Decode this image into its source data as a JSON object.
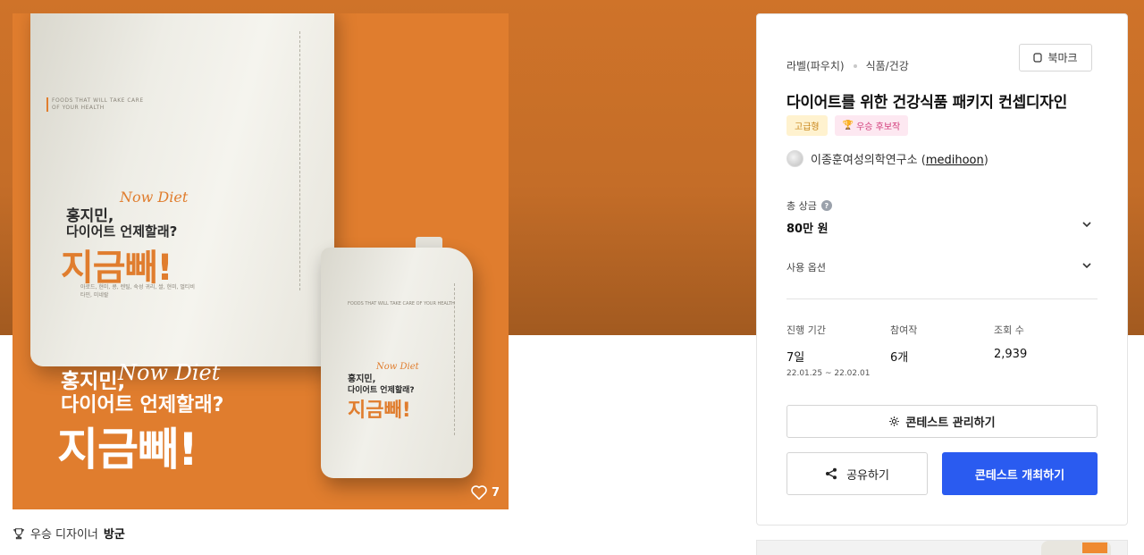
{
  "product": {
    "pouch_tagline": "FOODS THAT WILL TAKE CARE OF YOUR HEALTH",
    "copy_line1": "홍지민,",
    "copy_script": "Now Diet",
    "copy_line2": "다이어트 언제할래?",
    "copy_big": "지금빼!",
    "pouch_small_text": "아로드, 현미, 콩, 렌틸, 숙성 귀리, 쌀, 현미, 멀티비타민, 미네랄",
    "likes": "7",
    "colors": {
      "brand_orange": "#e07d2e",
      "pouch": "#eeede6"
    }
  },
  "winner": {
    "prefix": "우승 디자이너",
    "name": "방군"
  },
  "panel": {
    "category": "라벨(파우치)",
    "subcategory": "식품/건강",
    "bookmark_label": "북마크",
    "title": "다이어트를 위한 건강식품 패키지 컨셉디자인",
    "badge_grade": "고급형",
    "badge_winner": "우승 후보작",
    "host_name": "이종훈여성의학연구소",
    "host_handle": "medihoon",
    "prize_label": "총 상금",
    "prize_value": "80만 원",
    "usage_label": "사용 옵션",
    "stats": [
      {
        "label": "진행 기간",
        "value": "7일",
        "sub": "22.01.25 ~ 22.02.01"
      },
      {
        "label": "참여작",
        "value": "6개",
        "sub": ""
      },
      {
        "label": "조회 수",
        "value": "2,939",
        "sub": ""
      }
    ],
    "manage_label": "콘테스트 관리하기",
    "share_label": "공유하기",
    "host_contest_label": "콘테스트 개최하기",
    "colors": {
      "primary": "#2a5bf0"
    }
  }
}
